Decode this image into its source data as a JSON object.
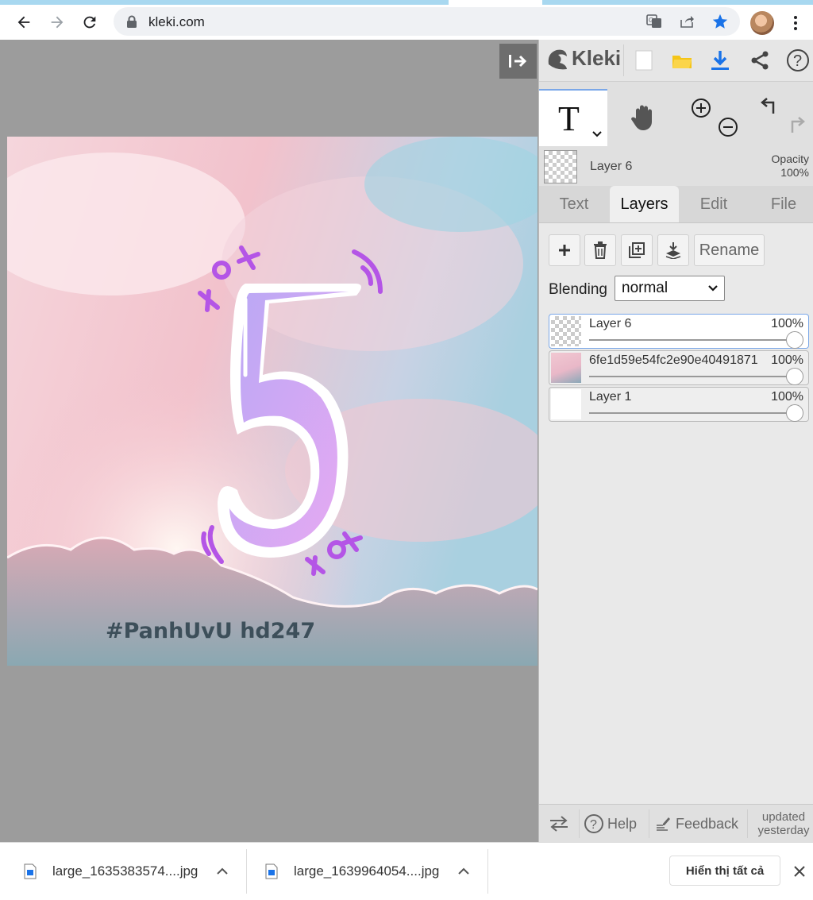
{
  "browser": {
    "url": "kleki.com"
  },
  "app": {
    "name": "Kleki"
  },
  "current_layer": {
    "name": "Layer 6",
    "opacity_label": "Opacity",
    "opacity_value": "100%"
  },
  "tabs": [
    {
      "label": "Text",
      "active": false
    },
    {
      "label": "Layers",
      "active": true
    },
    {
      "label": "Edit",
      "active": false
    },
    {
      "label": "File",
      "active": false
    }
  ],
  "layers_panel": {
    "rename_label": "Rename",
    "blending_label": "Blending",
    "blending_value": "normal",
    "layers": [
      {
        "name": "Layer 6",
        "opacity": "100%",
        "opacity_fraction": 1.0,
        "selected": true
      },
      {
        "name": "6fe1d59e54fc2e90e40491871",
        "opacity": "100%",
        "opacity_fraction": 1.0,
        "selected": false
      },
      {
        "name": "Layer 1",
        "opacity": "100%",
        "opacity_fraction": 1.0,
        "selected": false
      }
    ]
  },
  "canvas": {
    "big_digit": "5",
    "watermark": "#PanhUvU   hd247",
    "sticker_accent": "#b455e6"
  },
  "footer": {
    "help_label": "Help",
    "feedback_label": "Feedback",
    "updated_line1": "updated",
    "updated_line2": "yesterday"
  },
  "downloads": {
    "items": [
      {
        "filename": "large_1635383574....jpg"
      },
      {
        "filename": "large_1639964054....jpg"
      }
    ],
    "show_all_label": "Hiển thị tất cả"
  },
  "colors": {
    "accent_blue": "#1a73e8",
    "download_blue": "#1a73e8",
    "star_blue": "#1a73e8",
    "selected_layer_border": "#7aa7e8",
    "folder_yellow": "#f5c518"
  }
}
